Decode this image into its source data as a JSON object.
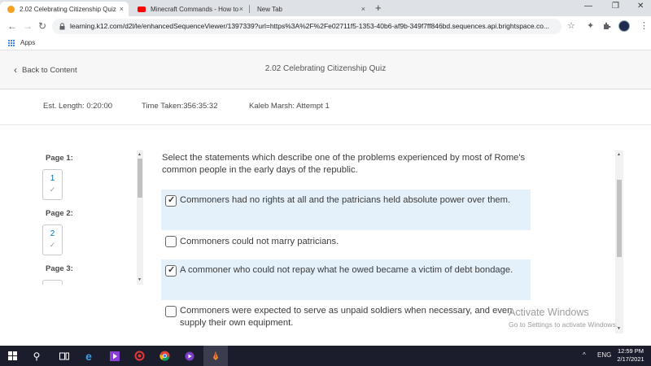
{
  "browser": {
    "tabs": [
      {
        "title": "2.02 Celebrating Citizenship Quiz",
        "close": "×",
        "active": true
      },
      {
        "title": "Minecraft Commands - How to #",
        "close": "×",
        "active": false
      },
      {
        "title": "New Tab",
        "close": "×",
        "active": false
      }
    ],
    "new_tab": "+",
    "window_controls": {
      "minimize": "—",
      "restore": "❐",
      "close": "✕"
    },
    "nav": {
      "back": "←",
      "forward": "→",
      "reload": "↻"
    },
    "url": "learning.k12.com/d2l/le/enhancedSequenceViewer/1397339?url=https%3A%2F%2Fe02711f5-1353-40b6-af9b-349f7ff846bd.sequences.api.brightspace.co...",
    "bookmarks": {
      "apps_label": "Apps"
    },
    "toolbar_icons": {
      "star": "☆",
      "extensions": "✦",
      "menu": "⋮"
    }
  },
  "header": {
    "back_label": "Back to Content",
    "back_chevron": "‹",
    "quiz_title": "2.02 Celebrating Citizenship Quiz"
  },
  "info": {
    "est_length": "Est. Length: 0:20:00",
    "time_taken": "Time Taken:356:35:32",
    "attempt": "Kaleb Marsh: Attempt 1"
  },
  "pages": [
    {
      "label": "Page 1:",
      "number": "1",
      "check": "✓"
    },
    {
      "label": "Page 2:",
      "number": "2",
      "check": "✓"
    },
    {
      "label": "Page 3:",
      "number": "",
      "check": ""
    }
  ],
  "question": {
    "prompt": "Select the statements which describe one of the problems experienced by most of Rome's common people in the early days of the republic.",
    "options": [
      {
        "text": "Commoners had no rights at all and the patricians held absolute power over them.",
        "checked": true,
        "tick": "✓"
      },
      {
        "text": "Commoners could not marry patricians.",
        "checked": false,
        "tick": ""
      },
      {
        "text": "A commoner who could not repay what he owed became a victim of debt bondage.",
        "checked": true,
        "tick": "✓"
      },
      {
        "text": "Commoners were expected to serve as unpaid soldiers when necessary, and even supply their own equipment.",
        "checked": false,
        "tick": ""
      }
    ]
  },
  "watermark": {
    "line1": "Activate Windows",
    "line2": "Go to Settings to activate Windows."
  },
  "taskbar": {
    "search_icon": "⚲",
    "tray_arrow": "^",
    "language": "ENG",
    "time": "12:59 PM",
    "date": "2/17/2021"
  },
  "colors": {
    "selected_option_bg": "#e4f0fa",
    "page_number_link": "#006fbf",
    "taskbar_bg": "#1b1d2c"
  }
}
